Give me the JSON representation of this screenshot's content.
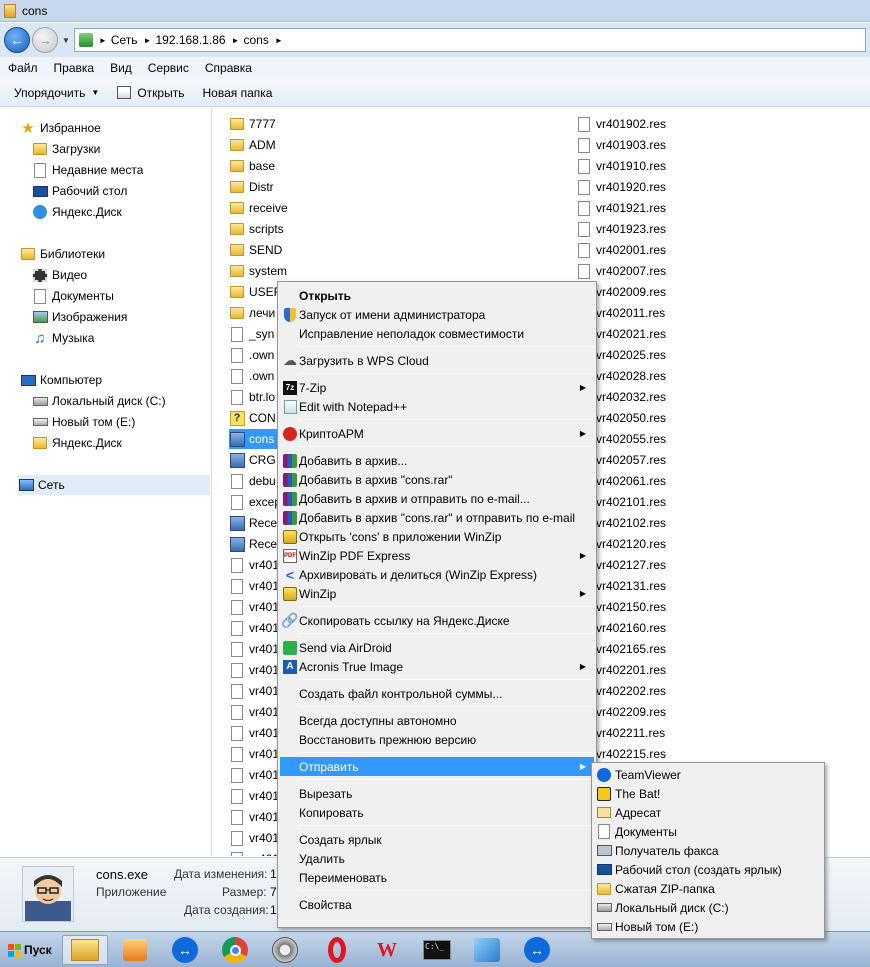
{
  "window": {
    "title": "cons"
  },
  "address": {
    "crumbs": [
      "Сеть",
      "192.168.1.86",
      "cons"
    ]
  },
  "menubar": [
    "Файл",
    "Правка",
    "Вид",
    "Сервис",
    "Справка"
  ],
  "toolbar": {
    "organize": "Упорядочить",
    "open": "Открыть",
    "new_folder": "Новая папка"
  },
  "nav": {
    "favorites": "Избранное",
    "favorites_items": [
      "Загрузки",
      "Недавние места",
      "Рабочий стол",
      "Яндекс.Диск"
    ],
    "libraries": "Библиотеки",
    "libraries_items": [
      "Видео",
      "Документы",
      "Изображения",
      "Музыка"
    ],
    "computer": "Компьютер",
    "computer_items": [
      "Локальный диск (C:)",
      "Новый том (E:)",
      "Яндекс.Диск"
    ],
    "network": "Сеть"
  },
  "files_col1": [
    {
      "name": "7777",
      "type": "folder"
    },
    {
      "name": "ADM",
      "type": "folder"
    },
    {
      "name": "base",
      "type": "folder"
    },
    {
      "name": "Distr",
      "type": "folder"
    },
    {
      "name": "receive",
      "type": "folder"
    },
    {
      "name": "scripts",
      "type": "folder"
    },
    {
      "name": "SEND",
      "type": "folder"
    },
    {
      "name": "system",
      "type": "folder"
    },
    {
      "name": "USER",
      "type": "folder"
    },
    {
      "name": "лечи",
      "type": "folder"
    },
    {
      "name": "_syn",
      "type": "doc"
    },
    {
      "name": ".own",
      "type": "doc"
    },
    {
      "name": ".own",
      "type": "doc"
    },
    {
      "name": "btr.lo",
      "type": "doc"
    },
    {
      "name": "CON",
      "type": "q"
    },
    {
      "name": "cons",
      "type": "app"
    },
    {
      "name": "CRG",
      "type": "app"
    },
    {
      "name": "debu",
      "type": "doc"
    },
    {
      "name": "excep",
      "type": "doc"
    },
    {
      "name": "Rece",
      "type": "app"
    },
    {
      "name": "Rece",
      "type": "app"
    },
    {
      "name": "vr401",
      "type": "doc"
    },
    {
      "name": "vr401",
      "type": "doc"
    },
    {
      "name": "vr401",
      "type": "doc"
    },
    {
      "name": "vr401",
      "type": "doc"
    },
    {
      "name": "vr401",
      "type": "doc"
    },
    {
      "name": "vr401",
      "type": "doc"
    },
    {
      "name": "vr401",
      "type": "doc"
    },
    {
      "name": "vr401",
      "type": "doc"
    },
    {
      "name": "vr401",
      "type": "doc"
    },
    {
      "name": "vr401",
      "type": "doc"
    },
    {
      "name": "vr401",
      "type": "doc"
    },
    {
      "name": "vr401",
      "type": "doc"
    },
    {
      "name": "vr401",
      "type": "doc"
    },
    {
      "name": "vr401",
      "type": "doc"
    },
    {
      "name": "vr401",
      "type": "doc"
    }
  ],
  "files_col2": [
    "vr401902.res",
    "vr401903.res",
    "vr401910.res",
    "vr401920.res",
    "vr401921.res",
    "vr401923.res",
    "vr402001.res",
    "vr402007.res",
    "vr402009.res",
    "vr402011.res",
    "vr402021.res",
    "vr402025.res",
    "vr402028.res",
    "vr402032.res",
    "vr402050.res",
    "vr402055.res",
    "vr402057.res",
    "vr402061.res",
    "vr402101.res",
    "vr402102.res",
    "vr402120.res",
    "vr402127.res",
    "vr402131.res",
    "vr402150.res",
    "vr402160.res",
    "vr402165.res",
    "vr402201.res",
    "vr402202.res",
    "vr402209.res",
    "vr402211.res",
    "vr402215.res"
  ],
  "details": {
    "name": "cons.exe",
    "kind": "Приложение",
    "modified_label": "Дата изменения:",
    "modified_value": "1",
    "size_label": "Размер:",
    "size_value": "7",
    "created_label": "Дата создания:",
    "created_value": "1"
  },
  "taskbar": {
    "start": "Пуск"
  },
  "context_menu": [
    {
      "label": "Открыть",
      "bold": true,
      "icon": "none"
    },
    {
      "label": "Запуск от имени администратора",
      "icon": "shield-icon"
    },
    {
      "label": "Исправление неполадок совместимости",
      "icon": "none"
    },
    {
      "sep": true
    },
    {
      "label": "Загрузить в WPS Cloud",
      "icon": "cloud-icon"
    },
    {
      "sep": true
    },
    {
      "label": "7-Zip",
      "icon": "7zip-icon",
      "sub": true
    },
    {
      "label": "Edit with Notepad++",
      "icon": "notepad-icon"
    },
    {
      "sep": true
    },
    {
      "label": "КриптоАРМ",
      "icon": "cryptoarm-icon",
      "sub": true
    },
    {
      "sep": true
    },
    {
      "label": "Добавить в архив...",
      "icon": "winrar-icon"
    },
    {
      "label": "Добавить в архив \"cons.rar\"",
      "icon": "winrar-icon"
    },
    {
      "label": "Добавить в архив и отправить по e-mail...",
      "icon": "winrar-icon"
    },
    {
      "label": "Добавить в архив \"cons.rar\" и отправить по e-mail",
      "icon": "winrar-icon"
    },
    {
      "label": "Открыть 'cons' в приложении WinZip",
      "icon": "winzip-icon"
    },
    {
      "label": "WinZip PDF Express",
      "icon": "pdf-icon",
      "sub": true
    },
    {
      "label": "Архивировать и делиться (WinZip Express)",
      "icon": "share-icon"
    },
    {
      "label": "WinZip",
      "icon": "winzip-icon",
      "sub": true
    },
    {
      "sep": true
    },
    {
      "label": "Скопировать ссылку на Яндекс.Диске",
      "icon": "link-icon"
    },
    {
      "sep": true
    },
    {
      "label": "Send via AirDroid",
      "icon": "airdroid-icon"
    },
    {
      "label": "Acronis True Image",
      "icon": "acronis-icon",
      "sub": true
    },
    {
      "sep": true
    },
    {
      "label": "Создать файл контрольной суммы...",
      "icon": "none"
    },
    {
      "sep": true
    },
    {
      "label": "Всегда доступны автономно",
      "icon": "none"
    },
    {
      "label": "Восстановить прежнюю версию",
      "icon": "none"
    },
    {
      "sep": true
    },
    {
      "label": "Отправить",
      "icon": "none",
      "sub": true,
      "hot": true
    },
    {
      "sep": true
    },
    {
      "label": "Вырезать",
      "icon": "none"
    },
    {
      "label": "Копировать",
      "icon": "none"
    },
    {
      "sep": true
    },
    {
      "label": "Создать ярлык",
      "icon": "none"
    },
    {
      "label": "Удалить",
      "icon": "none"
    },
    {
      "label": "Переименовать",
      "icon": "none"
    },
    {
      "sep": true
    },
    {
      "label": "Свойства",
      "icon": "none"
    }
  ],
  "send_to": [
    {
      "label": "TeamViewer",
      "icon": "teamviewer-icon"
    },
    {
      "label": "The Bat!",
      "icon": "thebat-icon"
    },
    {
      "label": "Адресат",
      "icon": "mail-recipient-icon"
    },
    {
      "label": "Документы",
      "icon": "documents-icon"
    },
    {
      "label": "Получатель факса",
      "icon": "fax-icon"
    },
    {
      "label": "Рабочий стол (создать ярлык)",
      "icon": "desktop-icon"
    },
    {
      "label": "Сжатая ZIP-папка",
      "icon": "zip-folder-icon"
    },
    {
      "label": "Локальный диск (C:)",
      "icon": "drive-c-icon"
    },
    {
      "label": "Новый том (E:)",
      "icon": "drive-e-icon"
    }
  ]
}
